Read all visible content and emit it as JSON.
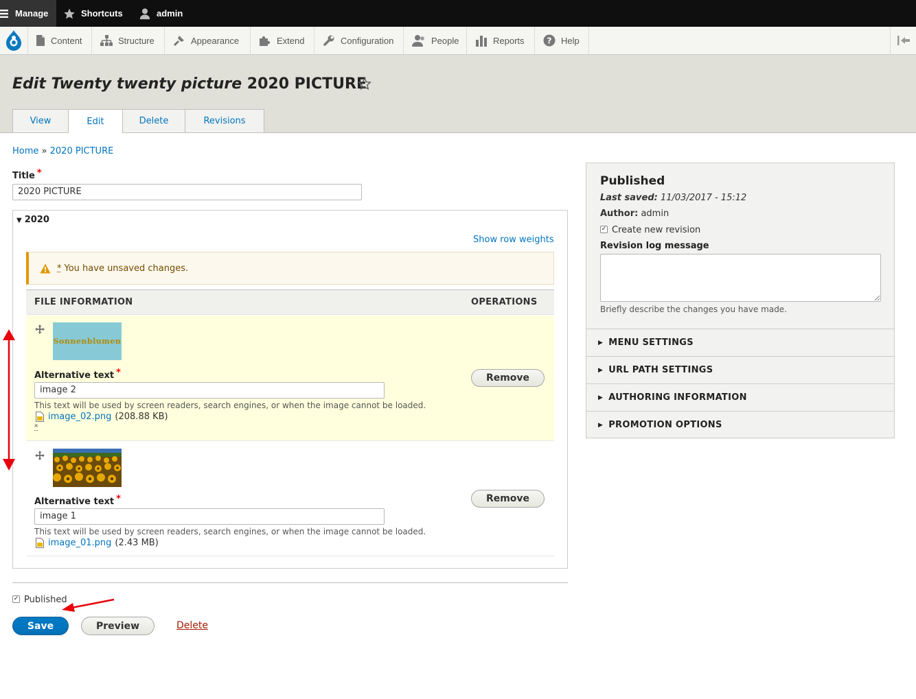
{
  "toolbar": {
    "manage": "Manage",
    "shortcuts": "Shortcuts",
    "user": "admin",
    "items": [
      "Content",
      "Structure",
      "Appearance",
      "Extend",
      "Configuration",
      "People",
      "Reports",
      "Help"
    ]
  },
  "page": {
    "title_italic": "Edit Twenty twenty picture",
    "title_rest": "2020 PICTURE",
    "tabs": [
      "View",
      "Edit",
      "Delete",
      "Revisions"
    ]
  },
  "breadcrumb": {
    "home": "Home",
    "sep": "»",
    "current": "2020 PICTURE"
  },
  "form": {
    "title_label": "Title",
    "title_value": "2020 PICTURE",
    "fieldset_legend": "2020",
    "show_row_weights": "Show row weights",
    "warning_star": "*",
    "warning": "You have unsaved changes.",
    "col_file": "FILE INFORMATION",
    "col_ops": "OPERATIONS",
    "alt_label": "Alternative text",
    "alt_desc": "This text will be used by screen readers, search engines, or when the image cannot be loaded.",
    "remove": "Remove",
    "rows": [
      {
        "thumb_text": "Sonnenblumen",
        "alt": "image 2",
        "file": "image_02.png",
        "size": "(208.88 KB)",
        "changed": "*"
      },
      {
        "alt": "image 1",
        "file": "image_01.png",
        "size": "(2.43 MB)"
      }
    ],
    "published_label": "Published",
    "save": "Save",
    "preview": "Preview",
    "delete": "Delete"
  },
  "sidebar": {
    "status": "Published",
    "last_saved_label": "Last saved:",
    "last_saved": "11/03/2017 - 15:12",
    "author_label": "Author:",
    "author": "admin",
    "new_revision": "Create new revision",
    "revision_label": "Revision log message",
    "revision_desc": "Briefly describe the changes you have made.",
    "sections": [
      "MENU SETTINGS",
      "URL PATH SETTINGS",
      "AUTHORING INFORMATION",
      "PROMOTION OPTIONS"
    ]
  },
  "colors": {
    "link": "#0074bd",
    "primary": "#0074bd",
    "annotation": "#e8000b",
    "warning": "#e29700"
  }
}
